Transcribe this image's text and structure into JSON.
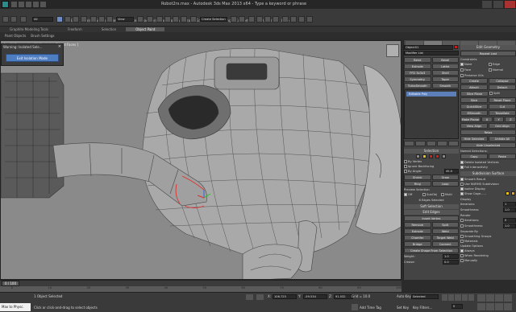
{
  "app": {
    "title": "Robot2rs.max - Autodesk 3ds Max 2013 x64 - Type a keyword or phrase"
  },
  "menus": [
    "Edit",
    "Tools",
    "Group",
    "Views",
    "Create",
    "Modifiers",
    "Animation",
    "Graph Editors",
    "Rendering",
    "Customize",
    "MAXScript",
    "Help"
  ],
  "toolbar": {
    "selection_filter": "All",
    "reference_coord": "View",
    "named_selection": "Create Selection Se"
  },
  "ribbon": {
    "tabs": [
      "Graphite Modeling Tools",
      "Freeform",
      "Selection",
      "Object Paint"
    ],
    "active_tab": "Object Paint",
    "sub_items": [
      "Paint Objects",
      "Brush Settings"
    ]
  },
  "viewport": {
    "label": "[ + ] [ Perspective ] [ Shaded + Edged Faces ]"
  },
  "isolate": {
    "title": "Warning: Isolated Sele...",
    "close": "×",
    "exit_button": "Exit Isolation Mode"
  },
  "command_panel": {
    "object_name": "Object01",
    "modifier_list": "Modifier List",
    "stack_buttons": [
      [
        "Bend",
        "Bevel"
      ],
      [
        "Extrude",
        "Lathe"
      ],
      [
        "FFD 3x3x3",
        "Shell"
      ],
      [
        "Symmetry",
        "Taper"
      ],
      [
        "TurboSmooth",
        "Smooth"
      ]
    ],
    "stack_item": "Editable Poly",
    "selection": {
      "header": "Selection",
      "by_vertex": "By Vertex",
      "ignore_backfacing": "Ignore Backfacing",
      "by_angle": "By Angle:",
      "angle_value": "45.0",
      "shrink": "Shrink",
      "grow": "Grow",
      "ring": "Ring",
      "loop": "Loop",
      "preview": "Preview Selection",
      "off": "Off",
      "subobj": "SubObj",
      "multi": "Multi",
      "status": "6 Edges Selected"
    },
    "soft_selection": "Soft Selection",
    "edit_edges": {
      "header": "Edit Edges",
      "insert_vertex": "Insert Vertex",
      "rows": [
        [
          "Remove",
          "Split"
        ],
        [
          "Extrude",
          "Weld"
        ],
        [
          "Chamfer",
          "Target Weld"
        ],
        [
          "Bridge",
          "Connect"
        ]
      ],
      "create_shape": "Create Shape From Selection",
      "weight_label": "Weight:",
      "weight": "1.0",
      "crease_label": "Crease:",
      "crease": "0.0"
    },
    "edit_geometry": {
      "header": "Edit Geometry",
      "repeat_last": "Repeat Last",
      "constraints": "Constraints",
      "none": "None",
      "edge": "Edge",
      "face": "Face",
      "normal": "Normal",
      "preserve_uvs": "Preserve UVs",
      "create": "Create",
      "collapse": "Collapse",
      "attach": "Attach",
      "detach": "Detach",
      "slice_plane": "Slice Plane",
      "split": "Split",
      "slice": "Slice",
      "reset_plane": "Reset Plane",
      "quickslice": "QuickSlice",
      "cut": "Cut",
      "msmooth": "MSmooth",
      "tessellate": "Tessellate",
      "make_planar": "Make Planar",
      "x": "X",
      "y": "Y",
      "z": "Z",
      "view_align": "View Align",
      "grid_align": "Grid Align",
      "relax": "Relax",
      "hide_selected": "Hide Selected",
      "unhide_all": "Unhide All",
      "hide_unselected": "Hide Unselected",
      "named_selections": "Named Selections:",
      "copy": "Copy",
      "paste": "Paste",
      "delete_isolated": "Delete Isolated Vertices",
      "full_interactivity": "Full Interactivity"
    },
    "subdivision": {
      "header": "Subdivision Surface",
      "smooth_result": "Smooth Result",
      "use_nurms": "Use NURMS Subdivision",
      "isoline": "Isoline Display",
      "show_cage": "Show Cage......",
      "display": "Display",
      "iterations_label": "Iterations:",
      "iterations": "1",
      "smoothness_label": "Smoothness:",
      "smoothness": "1.0",
      "render": "Render",
      "r_iterations": "0",
      "r_smoothness": "1.0",
      "separate_by": "Separate By",
      "smoothing_groups": "Smoothing Groups",
      "materials": "Materials",
      "update_options": "Update Options",
      "always": "Always",
      "when_rendering": "When Rendering",
      "manually": "Manually"
    }
  },
  "timeline": {
    "frame": "0 / 100",
    "ticks": [
      "0",
      "10",
      "20",
      "30",
      "40",
      "50",
      "60",
      "70",
      "80",
      "90",
      "100"
    ]
  },
  "status": {
    "selected": "1 Object Selected",
    "prompt": "Click or click-and-drag to select objects",
    "listener": "Max to Physc.",
    "x_label": "X:",
    "x": "106.725",
    "y_label": "Y:",
    "y": "-59.534",
    "z_label": "Z:",
    "z": "91.032",
    "grid": "Grid = 10.0",
    "auto_key": "Auto Key",
    "set_key": "Set Key",
    "selected_label": "Selected",
    "key_filters": "Key Filters...",
    "add_time_tag": "Add Time Tag",
    "frame_value": "0"
  },
  "colors": {
    "viewport": "#8a8a8a",
    "selected_edge": "#e03030",
    "accent": "#4e7dc2",
    "swatch_yellow": "#e6c020",
    "swatch_red": "#d02020"
  }
}
